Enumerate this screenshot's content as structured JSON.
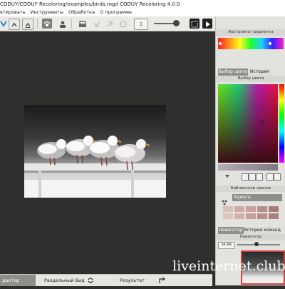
{
  "window": {
    "title": "CODUY/CODUY Recoloring/examples/birds.rngd CODUY Recoloring 4.0.0"
  },
  "menu": {
    "items": [
      "ктировать",
      "Инструменты",
      "Обработка",
      "О программе"
    ]
  },
  "toolbar": {
    "counter_value": "1"
  },
  "panels": {
    "gradient_settings": "Настройки градиента",
    "tabs_color": [
      "Выбор цвета",
      "История"
    ],
    "color_picker_title": "Выбор цвета",
    "libraries_title": "Библиотеки цветов",
    "library_name": "Бумага",
    "nav_tabs": [
      "Навигатор",
      "История команд"
    ],
    "navigator_title": "Навигатор",
    "zoom_value": "34.9%"
  },
  "bottom": {
    "editor_label": "дактор",
    "split_label": "Раздельный Вид",
    "result_label": "Результат"
  },
  "watermark": "liveinternet.club",
  "colors": {
    "background": "#2f302d",
    "panel": "#e2e2df",
    "active_tab": "#8e8e8a",
    "accent_blue": "#2d7fd6"
  },
  "swatches": [
    "#d9bdb7",
    "#cfa9a3",
    "#c9a09b",
    "#b88c89",
    "#a77b79",
    "#e0c2bb",
    "#d4b0aa",
    "#c69f99",
    "#b98e8a",
    "#aa817d"
  ]
}
